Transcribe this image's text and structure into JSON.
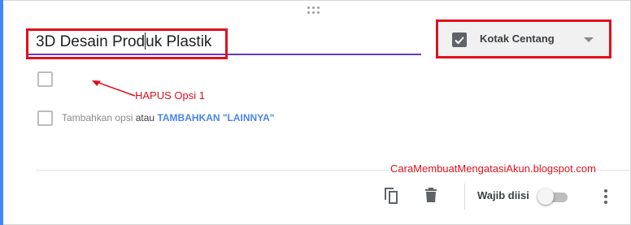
{
  "question": {
    "title_before_caret": "3D Desain Prod",
    "title_after_caret": "uk Plastik",
    "type_label": "Kotak Centang"
  },
  "options": {
    "add_option": "Tambahkan opsi",
    "or_word": "atau",
    "add_other": "TAMBAHKAN \"LAINNYA\""
  },
  "annotation": {
    "text": "HAPUS Opsi 1",
    "color": "#e0101c"
  },
  "watermark": "CaraMembuatMengatasiAkun.blogspot.com",
  "footer": {
    "required_label": "Wajib diisi",
    "required_on": false
  },
  "icons": {
    "drag": "drag-handle-icon",
    "type_checkbox": "checkbox-icon",
    "dropdown": "dropdown-arrow-icon",
    "duplicate": "duplicate-icon",
    "delete": "trash-icon",
    "more": "more-vert-icon"
  },
  "colors": {
    "accent": "#4285f4",
    "title_underline": "#673ab7",
    "link": "#4a86e8",
    "highlight_red": "#e0101c"
  }
}
